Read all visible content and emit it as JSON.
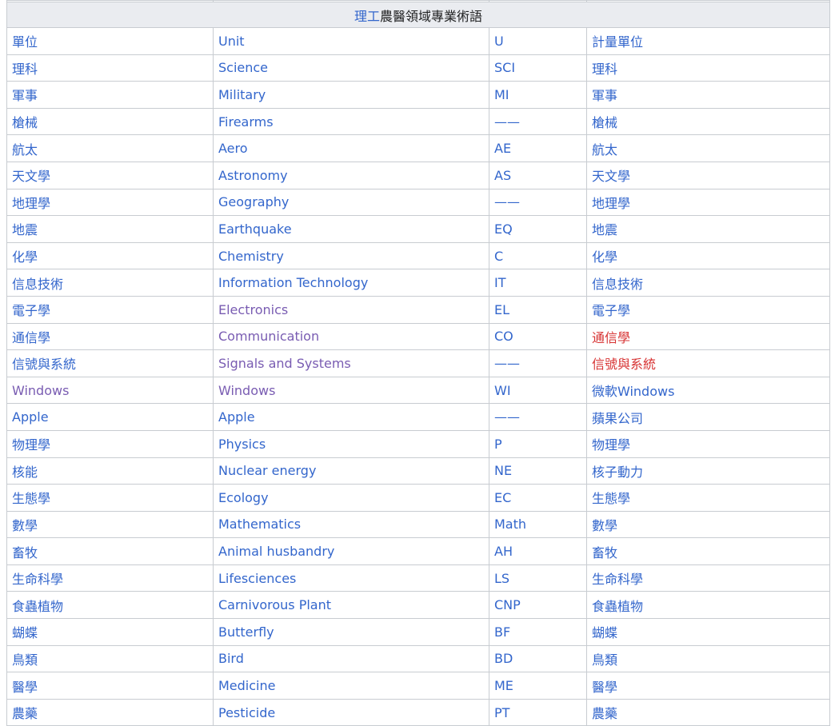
{
  "title": {
    "link": "理工",
    "rest": "農醫領域專業術語"
  },
  "colors": {
    "link": "#3366cc",
    "visited": "#795cb2",
    "redlink": "#d73333",
    "header_bg": "#eaecf0",
    "border": "#c8ccd1"
  },
  "rows": [
    {
      "zh": "單位",
      "en": "Unit",
      "abbr": "U",
      "alt": "計量單位"
    },
    {
      "zh": "理科",
      "en": "Science",
      "abbr": "SCI",
      "alt": "理科"
    },
    {
      "zh": "軍事",
      "en": "Military",
      "abbr": "MI",
      "alt": "軍事"
    },
    {
      "zh": "槍械",
      "en": "Firearms",
      "abbr": "——",
      "alt": "槍械"
    },
    {
      "zh": "航太",
      "en": "Aero",
      "abbr": "AE",
      "alt": "航太"
    },
    {
      "zh": "天文學",
      "en": "Astronomy",
      "abbr": "AS",
      "alt": "天文學"
    },
    {
      "zh": "地理學",
      "en": "Geography",
      "abbr": "——",
      "alt": "地理學"
    },
    {
      "zh": "地震",
      "en": "Earthquake",
      "abbr": "EQ",
      "alt": "地震"
    },
    {
      "zh": "化學",
      "en": "Chemistry",
      "abbr": "C",
      "alt": "化學"
    },
    {
      "zh": "信息技術",
      "en": "Information Technology",
      "abbr": "IT",
      "alt": "信息技術"
    },
    {
      "zh": "電子學",
      "en": "Electronics",
      "abbr": "EL",
      "alt": "電子學"
    },
    {
      "zh": "通信學",
      "en": "Communication",
      "abbr": "CO",
      "alt": "通信學"
    },
    {
      "zh": "信號與系統",
      "en": "Signals and Systems",
      "abbr": "——",
      "alt": "信號與系統"
    },
    {
      "zh": "Windows",
      "en": "Windows",
      "abbr": "WI",
      "alt": "微軟Windows"
    },
    {
      "zh": "Apple",
      "en": "Apple",
      "abbr": "——",
      "alt": "蘋果公司"
    },
    {
      "zh": "物理學",
      "en": "Physics",
      "abbr": "P",
      "alt": "物理學"
    },
    {
      "zh": "核能",
      "en": "Nuclear energy",
      "abbr": "NE",
      "alt": "核子動力"
    },
    {
      "zh": "生態學",
      "en": "Ecology",
      "abbr": "EC",
      "alt": "生態學"
    },
    {
      "zh": "數學",
      "en": "Mathematics",
      "abbr": "Math",
      "alt": "數學"
    },
    {
      "zh": "畜牧",
      "en": "Animal husbandry",
      "abbr": "AH",
      "alt": "畜牧"
    },
    {
      "zh": "生命科學",
      "en": "Lifesciences",
      "abbr": "LS",
      "alt": "生命科學"
    },
    {
      "zh": "食蟲植物",
      "en": "Carnivorous Plant",
      "abbr": "CNP",
      "alt": "食蟲植物"
    },
    {
      "zh": "蝴蝶",
      "en": "Butterfly",
      "abbr": "BF",
      "alt": "蝴蝶"
    },
    {
      "zh": "鳥類",
      "en": "Bird",
      "abbr": "BD",
      "alt": "鳥類"
    },
    {
      "zh": "醫學",
      "en": "Medicine",
      "abbr": "ME",
      "alt": "醫學"
    },
    {
      "zh": "農藥",
      "en": "Pesticide",
      "abbr": "PT",
      "alt": "農藥"
    }
  ]
}
